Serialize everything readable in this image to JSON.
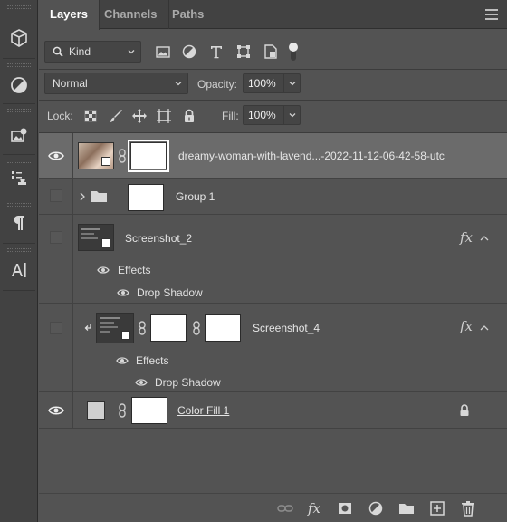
{
  "tabs": [
    {
      "label": "Layers",
      "active": true
    },
    {
      "label": "Channels",
      "active": false
    },
    {
      "label": "Paths",
      "active": false
    }
  ],
  "filter": {
    "kind_label": "Kind"
  },
  "blend": {
    "mode": "Normal",
    "opacity_label": "Opacity:",
    "opacity_value": "100%"
  },
  "lock": {
    "label": "Lock:",
    "fill_label": "Fill:",
    "fill_value": "100%"
  },
  "layers": {
    "l1": {
      "name": "dreamy-woman-with-lavend...-2022-11-12-06-42-58-utc",
      "visible": true,
      "selected": true
    },
    "l2": {
      "name": "Group 1",
      "visible": false
    },
    "l3": {
      "name": "Screenshot_2",
      "visible": false,
      "fx": "fx",
      "effects_label": "Effects",
      "effect": "Drop Shadow"
    },
    "l4": {
      "name": "Screenshot_4",
      "visible": false,
      "fx": "fx",
      "effects_label": "Effects",
      "effect": "Drop Shadow"
    },
    "l5": {
      "name": "Color Fill 1",
      "visible": true,
      "locked": true
    }
  },
  "footer": {
    "fx_label": "fx"
  },
  "colors": {
    "panel": "#535353",
    "selected_row": "#6b6b6b",
    "tabbar": "#424242"
  }
}
